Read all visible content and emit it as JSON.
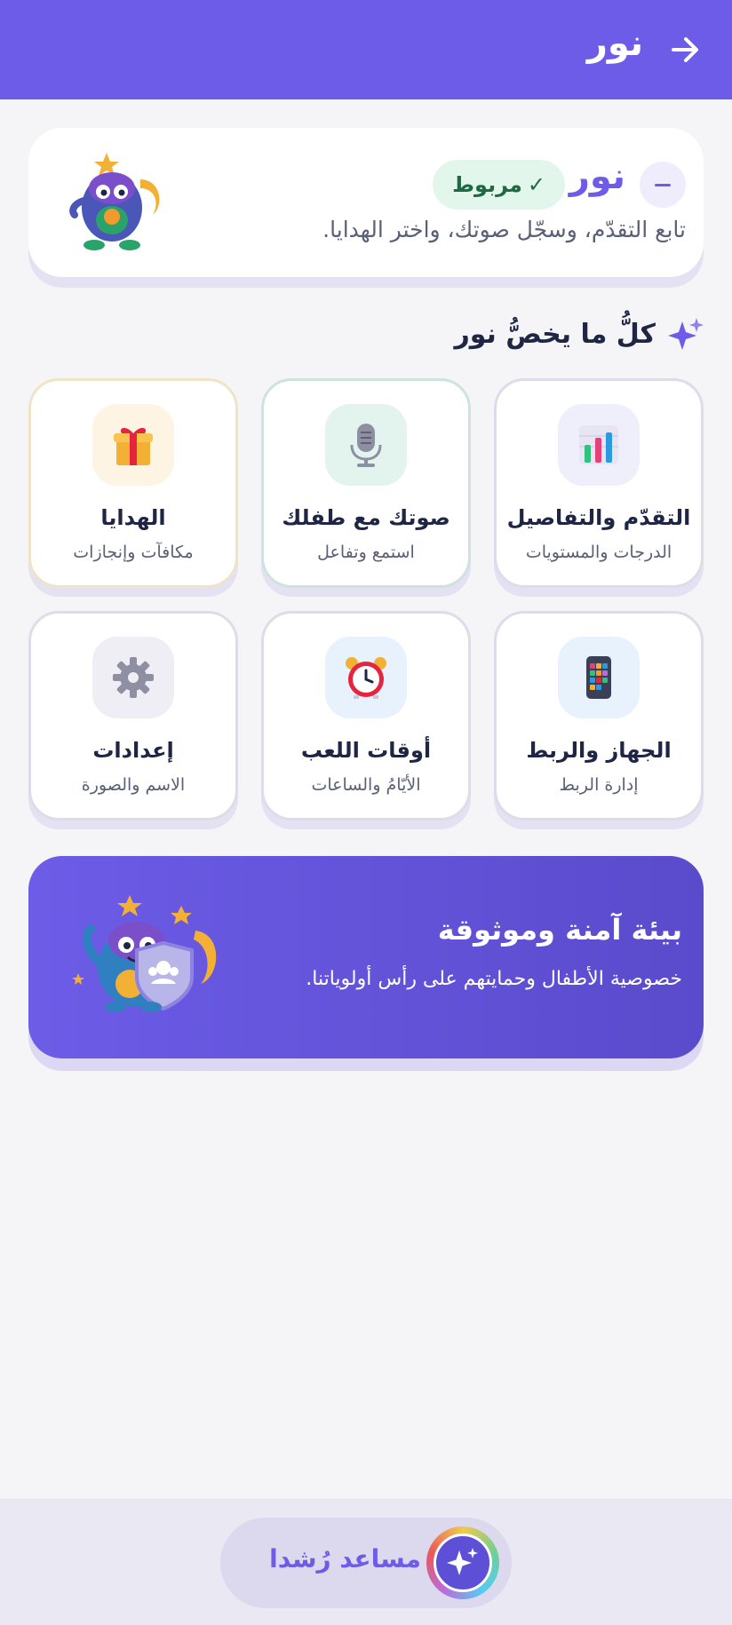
{
  "header": {
    "title": "نور",
    "back_icon": "arrow-right-icon",
    "background": "#6c5ce7"
  },
  "profile": {
    "name": "نور",
    "status": "مربوط",
    "status_mark": "✓",
    "subtitle": "تابع التقدّم، وسجّل صوتك، واختر الهدايا.",
    "collapse_icon": "minus-icon",
    "avatar_icon": "monster-mascot-icon"
  },
  "section": {
    "title": "كلُّ ما يخصُّ نور",
    "icon": "sparkles-icon"
  },
  "tiles": [
    {
      "title": "التقدّم والتفاصيل",
      "subtitle": "الدرجات والمستويات",
      "icon": "bar-chart-icon"
    },
    {
      "title": "صوتك مع طفلك",
      "subtitle": "استمع وتفاعل",
      "icon": "microphone-icon"
    },
    {
      "title": "الهدايا",
      "subtitle": "مكافآت وإنجازات",
      "icon": "gift-icon"
    },
    {
      "title": "الجهاز والربط",
      "subtitle": "إدارة الربط",
      "icon": "phone-icon"
    },
    {
      "title": "أوقات اللعب",
      "subtitle": "الأيّامُ والساعات",
      "icon": "alarm-clock-icon"
    },
    {
      "title": "إعدادات",
      "subtitle": "الاسم والصورة",
      "icon": "gear-icon"
    }
  ],
  "banner": {
    "title": "بيئة آمنة وموثوقة",
    "subtitle": "خصوصية الأطفال وحمايتهم على رأس أولوياتنا.",
    "art_icon": "mascot-shield-icon"
  },
  "assistant": {
    "label": "مساعد رُشدا",
    "icon": "sparkle-orb-icon"
  }
}
